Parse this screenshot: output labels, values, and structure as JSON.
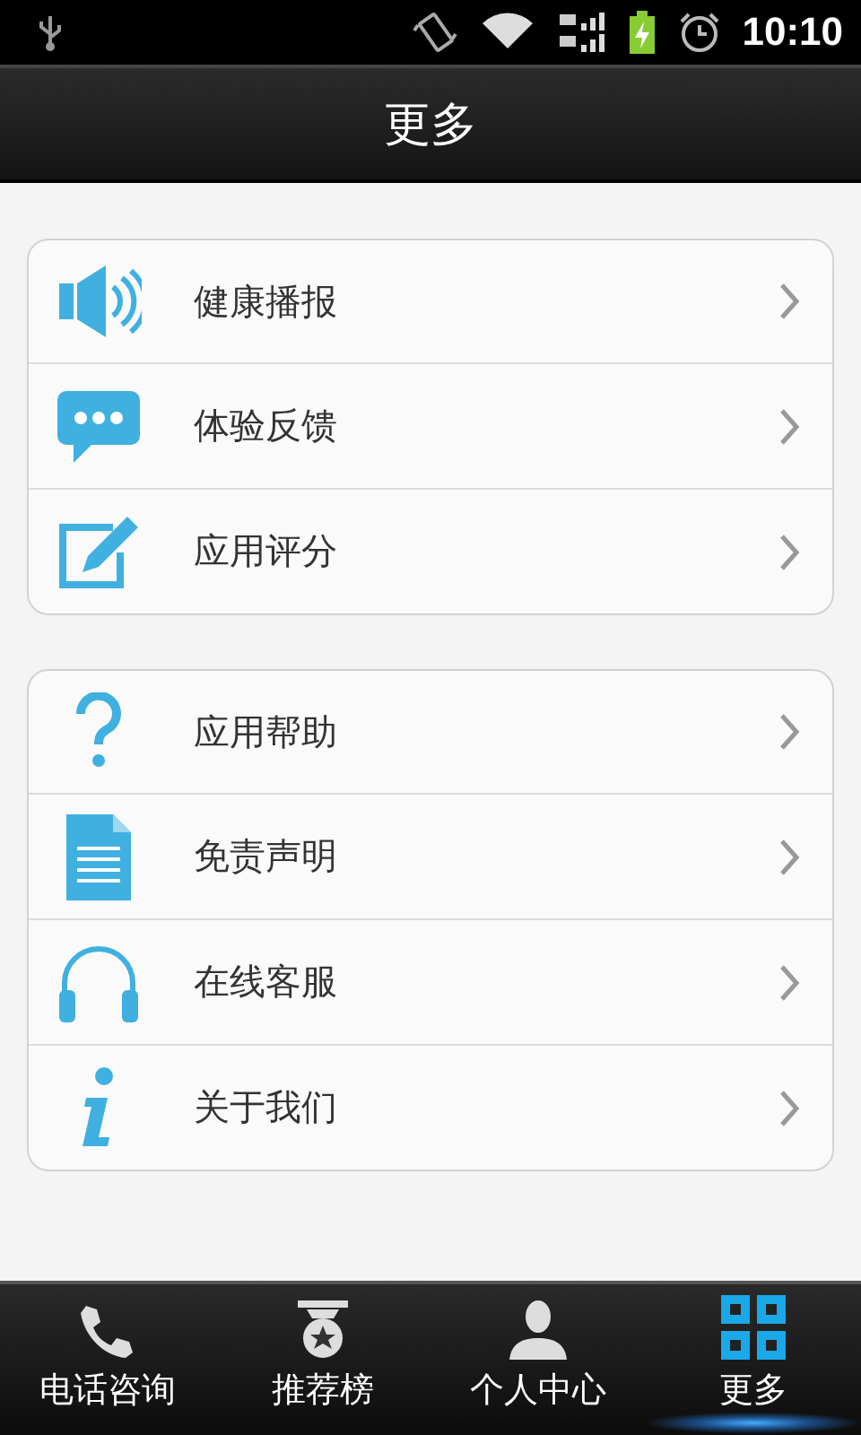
{
  "status_bar": {
    "time": "10:10"
  },
  "header": {
    "title": "更多"
  },
  "groups": [
    {
      "items": [
        {
          "label": "健康播报",
          "kind": "speaker"
        },
        {
          "label": "体验反馈",
          "kind": "chat"
        },
        {
          "label": "应用评分",
          "kind": "edit"
        }
      ]
    },
    {
      "items": [
        {
          "label": "应用帮助",
          "kind": "help"
        },
        {
          "label": "免责声明",
          "kind": "document"
        },
        {
          "label": "在线客服",
          "kind": "headset"
        },
        {
          "label": "关于我们",
          "kind": "info"
        }
      ]
    }
  ],
  "tabs": [
    {
      "label": "电话咨询",
      "kind": "phone",
      "selected": false
    },
    {
      "label": "推荐榜",
      "kind": "medal",
      "selected": false
    },
    {
      "label": "个人中心",
      "kind": "person",
      "selected": false
    },
    {
      "label": "更多",
      "kind": "grid",
      "selected": true
    }
  ]
}
